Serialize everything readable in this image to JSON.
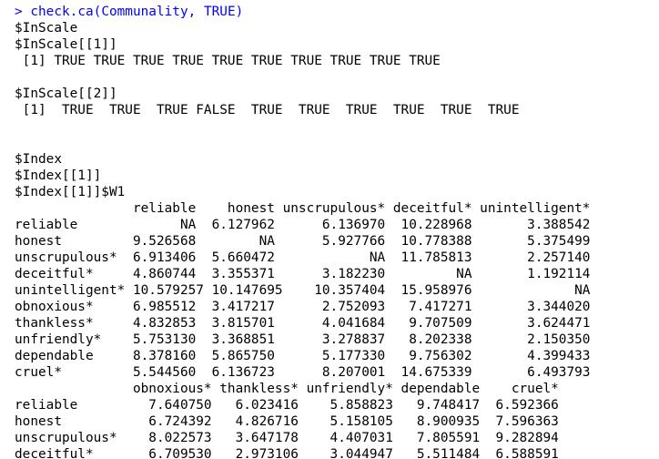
{
  "console": {
    "prompt": ">",
    "command": "check.ca(Communality, TRUE)",
    "output": [
      "$InScale",
      "$InScale[[1]]",
      " [1] TRUE TRUE TRUE TRUE TRUE TRUE TRUE TRUE TRUE TRUE",
      "",
      "$InScale[[2]]",
      " [1]  TRUE  TRUE  TRUE FALSE  TRUE  TRUE  TRUE  TRUE  TRUE  TRUE",
      "",
      "",
      "$Index",
      "$Index[[1]]",
      "$Index[[1]]$W1",
      "               reliable    honest unscrupulous* deceitful* unintelligent*",
      "reliable             NA  6.127962      6.136970  10.228968       3.388542",
      "honest         9.526568        NA      5.927766  10.778388       5.375499",
      "unscrupulous*  6.913406  5.660472            NA  11.785813       2.257140",
      "deceitful*     4.860744  3.355371      3.182230         NA       1.192114",
      "unintelligent* 10.579257 10.147695    10.357404  15.958976             NA",
      "obnoxious*     6.985512  3.417217      2.752093   7.417271       3.344020",
      "thankless*     4.832853  3.815701      4.041684   9.707509       3.624471",
      "unfriendly*    5.753130  3.368851      3.278837   8.202338       2.150350",
      "dependable     8.378160  5.865750      5.177330   9.756302       4.399433",
      "cruel*         5.544560  6.136723      8.207001  14.675339       6.493793",
      "               obnoxious* thankless* unfriendly* dependable    cruel*",
      "reliable         7.640750   6.023416    5.858823   9.748417  6.592366",
      "honest           6.724392   4.826716    5.158105   8.900935  7.596363",
      "unscrupulous*    8.022573   3.647178    4.407031   7.805591  9.282894",
      "deceitful*       6.709530   2.973106    3.044947   5.511484  6.588591"
    ]
  }
}
